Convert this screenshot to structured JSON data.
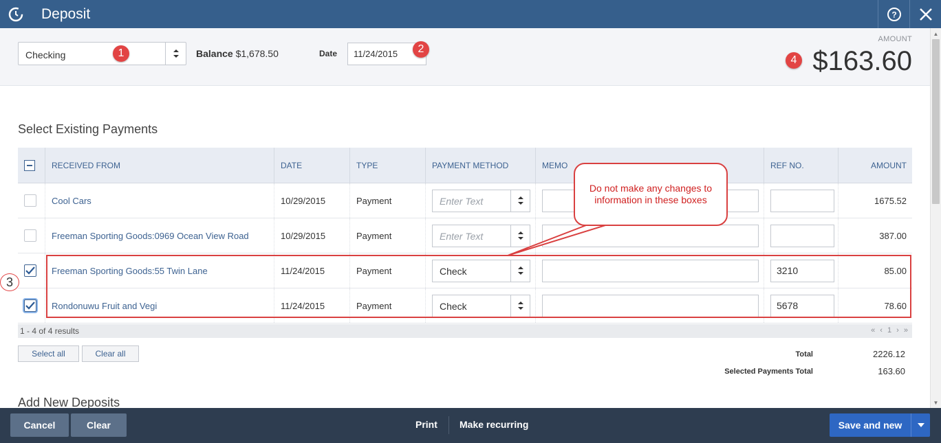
{
  "window": {
    "title": "Deposit"
  },
  "header": {
    "account": "Checking",
    "balance_label": "Balance",
    "balance_value": "$1,678.50",
    "date_label": "Date",
    "date_value": "11/24/2015",
    "amount_label": "AMOUNT",
    "amount_value": "$163.60"
  },
  "markers": {
    "m1": "1",
    "m2": "2",
    "m3": "3",
    "m4": "4"
  },
  "payments": {
    "section_title": "Select Existing Payments",
    "columns": [
      "RECEIVED FROM",
      "DATE",
      "TYPE",
      "PAYMENT METHOD",
      "MEMO",
      "REF NO.",
      "AMOUNT"
    ],
    "rows": [
      {
        "checked": false,
        "from": "Cool Cars",
        "date": "10/29/2015",
        "type": "Payment",
        "method": "Enter Text",
        "method_placeholder": true,
        "ref": "",
        "amount": "1675.52"
      },
      {
        "checked": false,
        "from": "Freeman Sporting Goods:0969 Ocean View Road",
        "date": "10/29/2015",
        "type": "Payment",
        "method": "Enter Text",
        "method_placeholder": true,
        "ref": "",
        "amount": "387.00"
      },
      {
        "checked": true,
        "from": "Freeman Sporting Goods:55 Twin Lane",
        "date": "11/24/2015",
        "type": "Payment",
        "method": "Check",
        "method_placeholder": false,
        "ref": "3210",
        "amount": "85.00"
      },
      {
        "checked": true,
        "from": "Rondonuwu Fruit and Vegi",
        "date": "11/24/2015",
        "type": "Payment",
        "method": "Check",
        "method_placeholder": false,
        "ref": "5678",
        "amount": "78.60"
      }
    ],
    "results_text": "1 - 4 of 4 results",
    "pager": "« ‹ 1 › »",
    "select_all": "Select all",
    "clear_all": "Clear all",
    "total_label": "Total",
    "total_value": "2226.12",
    "selected_total_label": "Selected Payments Total",
    "selected_total_value": "163.60"
  },
  "callout": {
    "text": "Do not make any changes to information in these boxes"
  },
  "add_new": {
    "title": "Add New Deposits"
  },
  "footer": {
    "cancel": "Cancel",
    "clear": "Clear",
    "print": "Print",
    "make_recurring": "Make recurring",
    "save_and_new": "Save and new"
  },
  "colors": {
    "titlebar": "#365f8c",
    "link": "#3d6291",
    "footer": "#2e3d50",
    "primary": "#2e67c3",
    "callout": "#d94040"
  }
}
